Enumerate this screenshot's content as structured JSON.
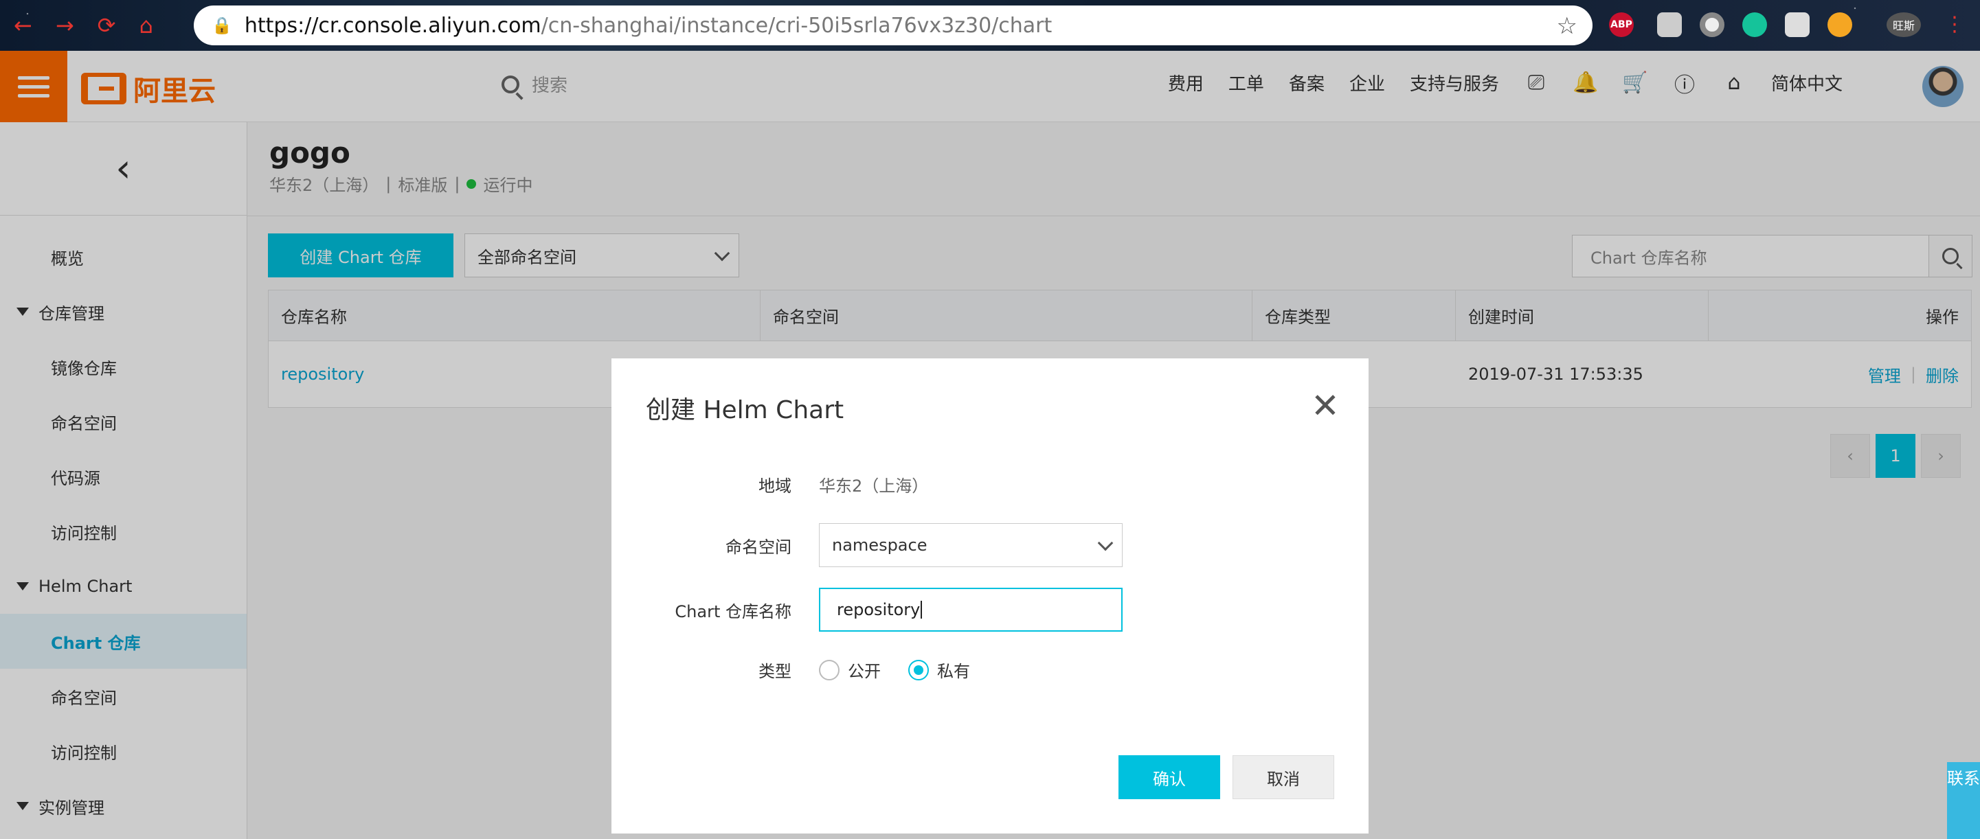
{
  "browser": {
    "url_host": "https://cr.console.aliyun.com",
    "url_path": "/cn-shanghai/instance/cri-50i5srla76vx3z30/chart",
    "ext_abp": "ABP",
    "ext_user": "旺斯"
  },
  "header": {
    "logo_text": "阿里云",
    "search_placeholder": "搜索",
    "nav": [
      "费用",
      "工单",
      "备案",
      "企业",
      "支持与服务"
    ],
    "language": "简体中文"
  },
  "sidebar": {
    "items": [
      {
        "label": "概览",
        "kind": "item"
      },
      {
        "label": "仓库管理",
        "kind": "group"
      },
      {
        "label": "镜像仓库",
        "kind": "sub"
      },
      {
        "label": "命名空间",
        "kind": "sub"
      },
      {
        "label": "代码源",
        "kind": "sub"
      },
      {
        "label": "访问控制",
        "kind": "sub"
      },
      {
        "label": "Helm Chart",
        "kind": "group"
      },
      {
        "label": "Chart 仓库",
        "kind": "sub",
        "active": true
      },
      {
        "label": "命名空间",
        "kind": "sub"
      },
      {
        "label": "访问控制",
        "kind": "sub"
      },
      {
        "label": "实例管理",
        "kind": "group"
      }
    ]
  },
  "instance": {
    "name": "gogo",
    "region": "华东2（上海）",
    "sep": "|",
    "edition": "标准版",
    "status": "运行中",
    "status_color": "#1ec040"
  },
  "toolbar": {
    "create_label": "创建 Chart 仓库",
    "namespace_filter": "全部命名空间",
    "search_placeholder": "Chart 仓库名称"
  },
  "table": {
    "columns": [
      "仓库名称",
      "命名空间",
      "仓库类型",
      "创建时间",
      "操作"
    ],
    "rows": [
      {
        "name": "repository",
        "namespace": "",
        "type": "",
        "created": "2019-07-31 17:53:35",
        "manage": "管理",
        "delete": "删除"
      }
    ]
  },
  "pagination": {
    "current": "1"
  },
  "modal": {
    "title": "创建 Helm Chart",
    "region_label": "地域",
    "region_value": "华东2（上海）",
    "namespace_label": "命名空间",
    "namespace_value": "namespace",
    "repo_label": "Chart 仓库名称",
    "repo_value": "repository",
    "type_label": "类型",
    "type_public": "公开",
    "type_private": "私有",
    "selected_type": "私有",
    "ok_label": "确认",
    "cancel_label": "取消"
  },
  "contact_label": "联系",
  "colors": {
    "accent": "#00c1de",
    "brand": "#ff6a00"
  }
}
